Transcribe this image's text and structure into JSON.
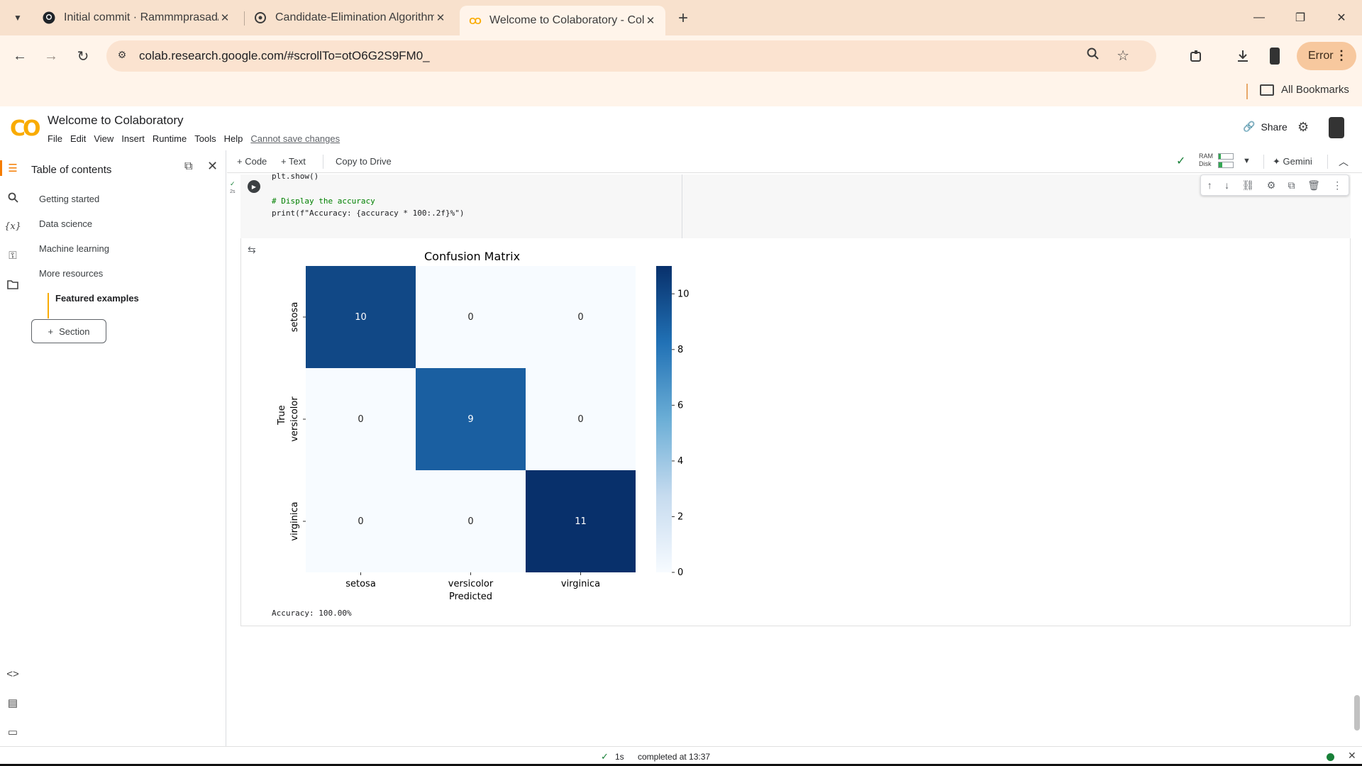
{
  "browser": {
    "tabs": [
      {
        "title": "Initial commit · Rammmprasad/",
        "icon": "github-icon",
        "active": false
      },
      {
        "title": "Candidate-Elimination Algorithm",
        "icon": "chatgpt-icon",
        "active": false
      },
      {
        "title": "Welcome to Colaboratory - Col",
        "icon": "colab-icon",
        "active": true
      }
    ],
    "url": "colab.research.google.com/#scrollTo=otO6G2S9FM0_",
    "profile_label": "Error",
    "bookmarks_label": "All Bookmarks"
  },
  "colab": {
    "logo": "CO",
    "title": "Welcome to Colaboratory",
    "menu": [
      "File",
      "Edit",
      "View",
      "Insert",
      "Runtime",
      "Tools",
      "Help"
    ],
    "cannot_save": "Cannot save changes",
    "share_label": "Share"
  },
  "toc": {
    "title": "Table of contents",
    "items": [
      "Getting started",
      "Data science",
      "Machine learning",
      "More resources"
    ],
    "featured": "Featured examples",
    "section_button": "Section"
  },
  "nb_toolbar": {
    "code": "+ Code",
    "text": "+ Text",
    "copy_to_drive": "Copy to Drive",
    "ram": "RAM",
    "disk": "Disk",
    "gemini": "Gemini"
  },
  "cell": {
    "exec_count": "2s",
    "line1": "plt.show()",
    "line3_comment": "# Display the accuracy",
    "line4": "print(f\"Accuracy: {accuracy * 100:.2f}%\")",
    "output_accuracy": "Accuracy: 100.00%"
  },
  "chart_data": {
    "type": "heatmap",
    "title": "Confusion Matrix",
    "xlabel": "Predicted",
    "ylabel": "True",
    "x_categories": [
      "setosa",
      "versicolor",
      "virginica"
    ],
    "y_categories": [
      "setosa",
      "versicolor",
      "virginica"
    ],
    "values": [
      [
        10,
        0,
        0
      ],
      [
        0,
        9,
        0
      ],
      [
        0,
        0,
        11
      ]
    ],
    "colorbar": {
      "min": 0,
      "max": 11,
      "ticks": [
        0,
        2,
        4,
        6,
        8,
        10
      ],
      "colormap": "Blues"
    }
  },
  "status": {
    "time": "1s",
    "text": "completed at 13:37"
  },
  "colors": {
    "tab_bg": "#f8e1cd",
    "accent": "#f9ab00",
    "status_ok": "#188038"
  }
}
